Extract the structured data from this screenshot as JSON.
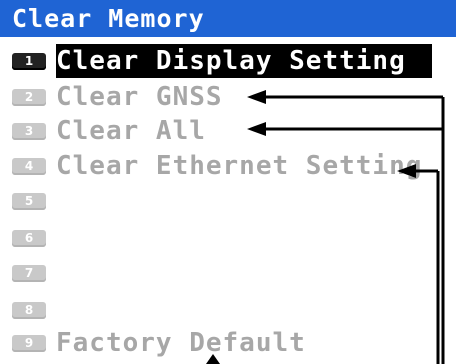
{
  "title": "Clear Memory",
  "menu": {
    "items": [
      {
        "key": "1",
        "label": "Clear Display Setting"
      },
      {
        "key": "2",
        "label": "Clear GNSS"
      },
      {
        "key": "3",
        "label": "Clear All"
      },
      {
        "key": "4",
        "label": "Clear Ethernet Setting"
      },
      {
        "key": "5",
        "label": ""
      },
      {
        "key": "6",
        "label": ""
      },
      {
        "key": "7",
        "label": ""
      },
      {
        "key": "8",
        "label": ""
      },
      {
        "key": "9",
        "label": "Factory Default"
      }
    ],
    "selected_key": "1"
  },
  "colors": {
    "title_bar": "#1f64d4",
    "selected_bg": "#000000",
    "dimmed_text": "#a7a7a7"
  }
}
